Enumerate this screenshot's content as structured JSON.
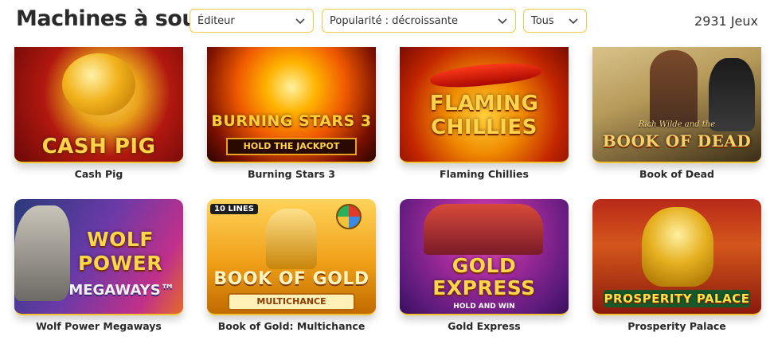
{
  "header": {
    "title": "Machines à sous",
    "publisher_select": "Éditeur",
    "sort_select": "Popularité : décroissante",
    "type_select": "Tous",
    "game_count": "2931 Jeux"
  },
  "games": [
    {
      "name": "Cash Pig",
      "logo": "CASH PIG",
      "sublogo": ""
    },
    {
      "name": "Burning Stars 3",
      "logo": "BURNING STARS 3",
      "sublogo": "HOLD THE JACKPOT"
    },
    {
      "name": "Flaming Chillies",
      "logo": "FLAMING CHILLIES",
      "sublogo": ""
    },
    {
      "name": "Book of Dead",
      "logo": "BOOK OF DEAD",
      "sublogo": "Rich Wilde and the"
    },
    {
      "name": "Wolf Power Megaways",
      "logo": "WOLF POWER",
      "sublogo": "MEGAWAYS™"
    },
    {
      "name": "Book of Gold: Multichance",
      "logo": "BOOK OF GOLD",
      "sublogo": "MULTICHANCE",
      "badge": "10 LINES"
    },
    {
      "name": "Gold Express",
      "logo": "GOLD EXPRESS",
      "sublogo": "HOLD AND WIN"
    },
    {
      "name": "Prosperity Palace",
      "logo": "PROSPERITY PALACE",
      "sublogo": ""
    }
  ],
  "colors": {
    "accent": "#f2c94c",
    "text": "#2a2a2a"
  }
}
